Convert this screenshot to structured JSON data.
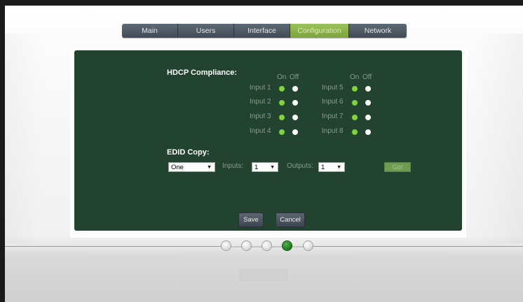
{
  "nav": {
    "tabs": [
      {
        "label": "Main"
      },
      {
        "label": "Users"
      },
      {
        "label": "Interface"
      },
      {
        "label": "Configuration",
        "active": true
      },
      {
        "label": "Network"
      }
    ]
  },
  "hdcp": {
    "title": "HDCP Compliance:",
    "on_label": "On",
    "off_label": "Off",
    "inputs": [
      {
        "label": "Input 1",
        "state": "On"
      },
      {
        "label": "Input 2",
        "state": "On"
      },
      {
        "label": "Input 3",
        "state": "On"
      },
      {
        "label": "Input 4",
        "state": "On"
      },
      {
        "label": "Input 5",
        "state": "On"
      },
      {
        "label": "Input 6",
        "state": "On"
      },
      {
        "label": "Input 7",
        "state": "On"
      },
      {
        "label": "Input 8",
        "state": "On"
      }
    ]
  },
  "edid": {
    "title": "EDID Copy:",
    "mode_value": "One",
    "inputs_label": "Inputs:",
    "inputs_value": "1",
    "outputs_label": "Outputs:",
    "outputs_value": "1",
    "go_label": "Go!"
  },
  "actions": {
    "save_label": "Save",
    "cancel_label": "Cancel"
  },
  "pager": {
    "pages": 5,
    "current": 4
  },
  "colors": {
    "panel": "#22432f",
    "active_tab": "#8db14a",
    "on_dot": "#7fd43a",
    "pager_active": "#1f7a1f"
  }
}
